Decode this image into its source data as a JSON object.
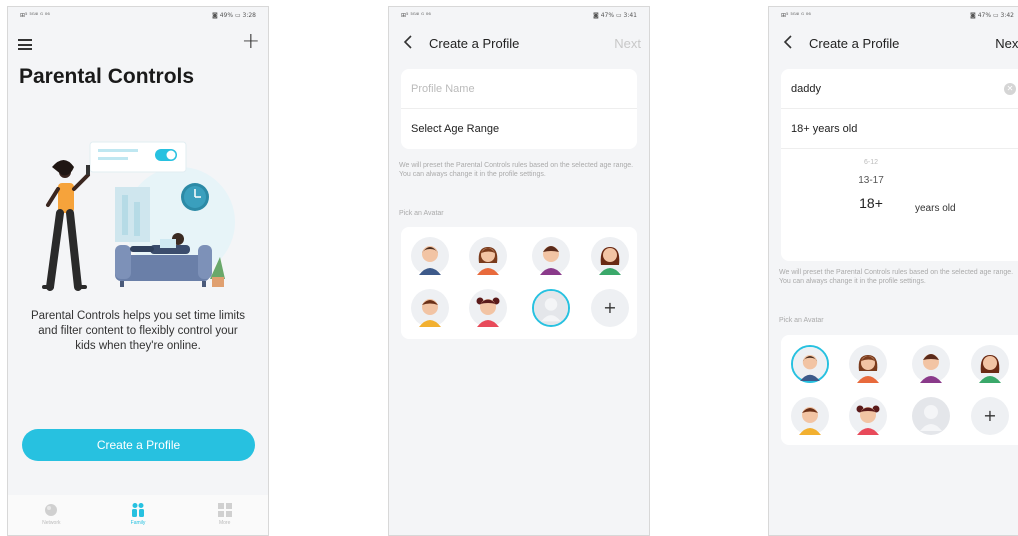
{
  "screen1": {
    "status_left": "⊞⁵ ⁵ᴳ⁴ᴵ ᴳ ⁰⁶",
    "status_right": "◙ 49% ▭ 3:28",
    "title": "Parental Controls",
    "description": "Parental Controls helps you set time limits and filter content to flexibly control your kids when they're online.",
    "cta_label": "Create a Profile",
    "tabs": [
      {
        "label": "Network",
        "icon": "globe-icon",
        "active": false
      },
      {
        "label": "Family",
        "icon": "family-icon",
        "active": true
      },
      {
        "label": "More",
        "icon": "grid-icon",
        "active": false
      }
    ]
  },
  "screen2": {
    "status_left": "⊞⁵ ⁵ᴳ⁴ᴵ ᴳ ⁰⁶",
    "status_right": "◙ 47% ▭ 3:41",
    "title": "Create a Profile",
    "next_label": "Next",
    "name_placeholder": "Profile Name",
    "age_label": "Select Age Range",
    "note": "We will preset the Parental Controls rules based on the selected age range. You can always change it in the profile settings.",
    "avatar_label": "Pick an Avatar",
    "add_label": "+"
  },
  "screen3": {
    "status_left": "⊞⁵ ⁵ᴳ⁴ᴵ ᴳ ⁰⁶",
    "status_right": "◙ 47% ▭ 3:42",
    "title": "Create a Profile",
    "next_label": "Next",
    "name_value": "daddy",
    "age_value": "18+ years old",
    "wheel_options": [
      "6-12",
      "13-17",
      "18+"
    ],
    "wheel_suffix": "years old",
    "note": "We will preset the Parental Controls rules based on the selected age range. You can always change it in the profile settings.",
    "avatar_label": "Pick an Avatar",
    "add_label": "+"
  },
  "colors": {
    "accent": "#27c1e0",
    "background": "#f4f5f7",
    "disabled": "#c8c8c8"
  }
}
